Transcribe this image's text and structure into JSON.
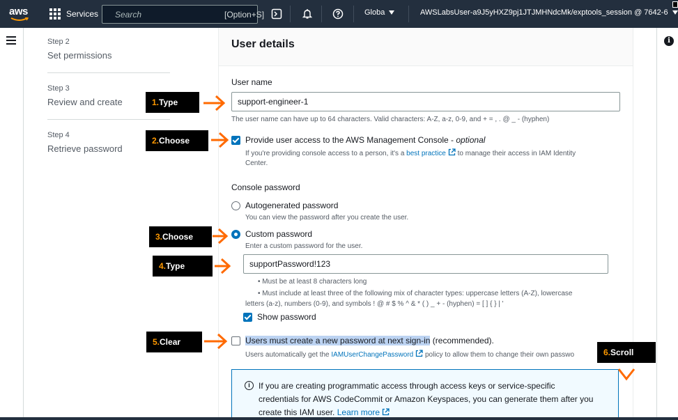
{
  "topnav": {
    "logo_text": "aws",
    "services_label": "Services",
    "search_placeholder": "Search",
    "search_shortcut": "[Option+S]",
    "region_label": "Globa",
    "account_label": "AWSLabsUser-a9J5yHXZ9pj1JTJMHNdcMk/exptools_session @ 7642-6"
  },
  "steps": [
    {
      "num": "Step 2",
      "title": "Set permissions"
    },
    {
      "num": "Step 3",
      "title": "Review and create"
    },
    {
      "num": "Step 4",
      "title": "Retrieve password"
    }
  ],
  "main": {
    "title": "User details",
    "user_name_label": "User name",
    "user_name_value": "support-engineer-1",
    "user_name_hint": "The user name can have up to 64 characters. Valid characters: A-Z, a-z, 0-9, and + = , . @ _ - (hyphen)",
    "console_access": {
      "label": "Provide user access to the AWS Management Console - ",
      "label_optional": "optional",
      "desc_before": "If you're providing console access to a person, it's a ",
      "desc_link": "best practice",
      "desc_after": " to manage their access in IAM Identity",
      "desc_line2": "Center.",
      "checked": true
    },
    "console_password_label": "Console password",
    "options": [
      {
        "label": "Autogenerated password",
        "desc": "You can view the password after you create the user.",
        "selected": false
      },
      {
        "label": "Custom password",
        "desc": "Enter a custom password for the user.",
        "selected": true
      }
    ],
    "password_value": "supportPassword!123",
    "rules": [
      "Must be at least 8 characters long",
      "Must include at least three of the following mix of character types: uppercase letters (A-Z), lowercase",
      "letters (a-z), numbers (0-9), and symbols ! @ # $ % ^ & * ( ) _ + - (hyphen) = [ ] { } | '"
    ],
    "show_password_label": "Show password",
    "show_password_checked": true,
    "must_reset": {
      "label_highlight": "Users must create a new password at next sign-in",
      "label_rest": " (recommended).",
      "desc_before": "Users automatically get the ",
      "desc_link": "IAMUserChangePassword",
      "desc_after": " policy to allow them to change their own passwo",
      "checked": false
    },
    "info": {
      "line1": "If you are creating programmatic access through access keys or service-specific",
      "line2": "credentials for AWS CodeCommit or Amazon Keyspaces, you can generate them after you",
      "line3_before": "create this IAM user. ",
      "line3_link": "Learn more"
    }
  },
  "annotations": [
    {
      "num": "1.",
      "text": " Type"
    },
    {
      "num": "2.",
      "text": " Choose"
    },
    {
      "num": "3.",
      "text": " Choose"
    },
    {
      "num": "4.",
      "text": " Type"
    },
    {
      "num": "5.",
      "text": " Clear"
    },
    {
      "num": "6.",
      "text": " Scroll"
    }
  ],
  "colors": {
    "accent": "#0073bb",
    "nav_bg": "#232f3e",
    "annotation_orange": "#ff9900"
  }
}
